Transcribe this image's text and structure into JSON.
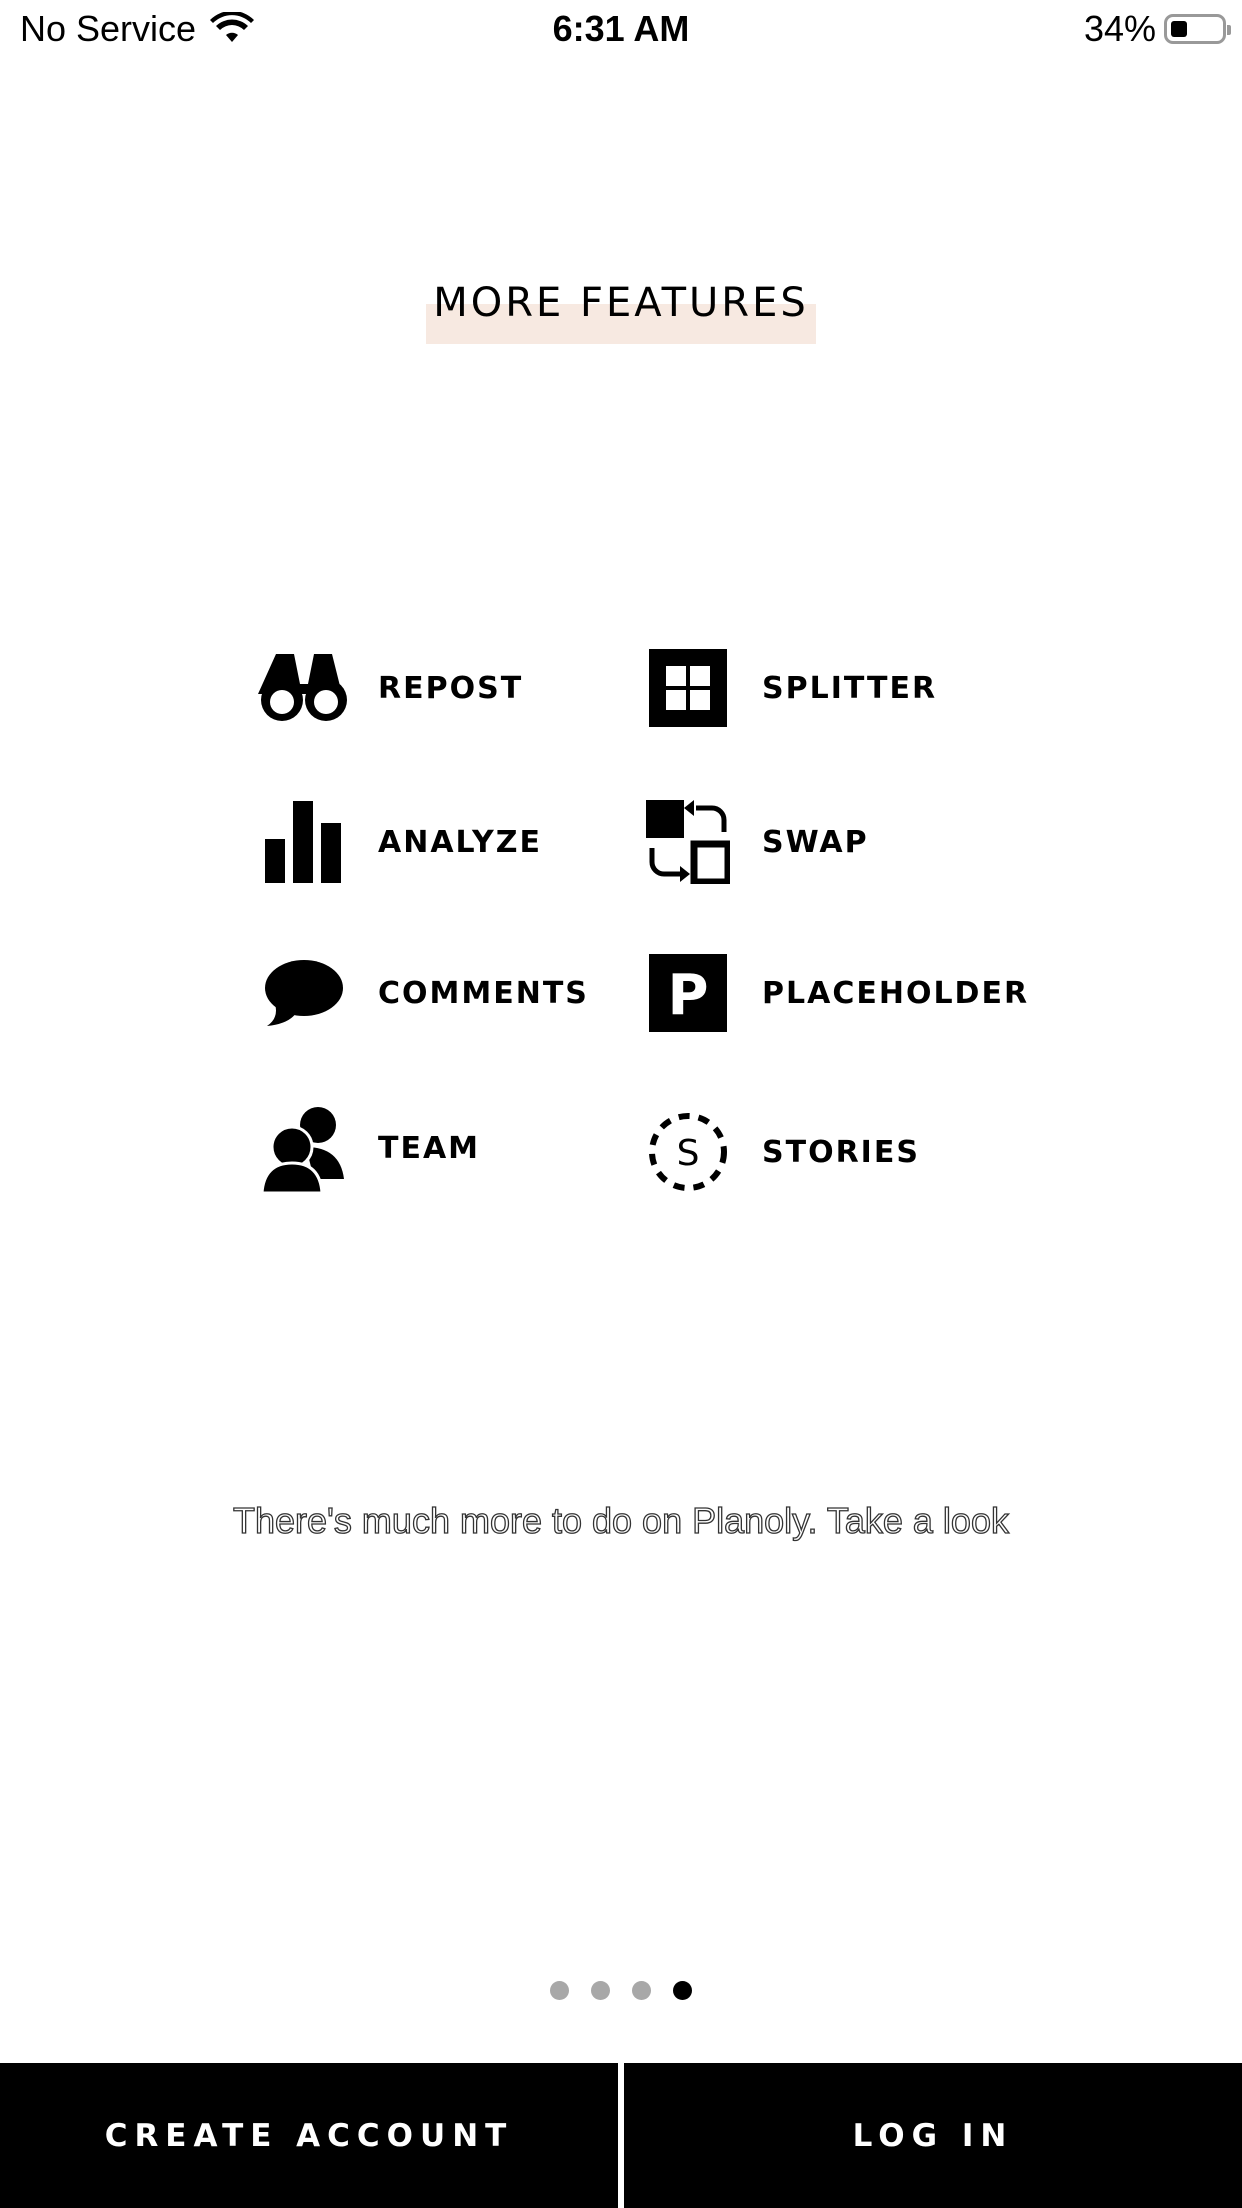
{
  "status_bar": {
    "carrier": "No Service",
    "time": "6:31 AM",
    "battery_percent": "34%",
    "battery_level": 0.34
  },
  "title": "MORE FEATURES",
  "features": [
    {
      "label": "REPOST",
      "icon": "binoculars-icon"
    },
    {
      "label": "SPLITTER",
      "icon": "grid-icon"
    },
    {
      "label": "ANALYZE",
      "icon": "bar-chart-icon"
    },
    {
      "label": "SWAP",
      "icon": "swap-icon"
    },
    {
      "label": "COMMENTS",
      "icon": "speech-bubble-icon"
    },
    {
      "label": "PLACEHOLDER",
      "icon": "placeholder-p-icon"
    },
    {
      "label": "TEAM",
      "icon": "team-icon"
    },
    {
      "label": "STORIES",
      "icon": "stories-icon"
    }
  ],
  "tagline": "There's much more to do on Planoly. Take a look",
  "pager": {
    "total": 4,
    "active": 4
  },
  "buttons": {
    "create_account": "CREATE ACCOUNT",
    "log_in": "LOG IN"
  },
  "colors": {
    "title_highlight": "#f7e9e1",
    "button_bar": "#000000"
  }
}
